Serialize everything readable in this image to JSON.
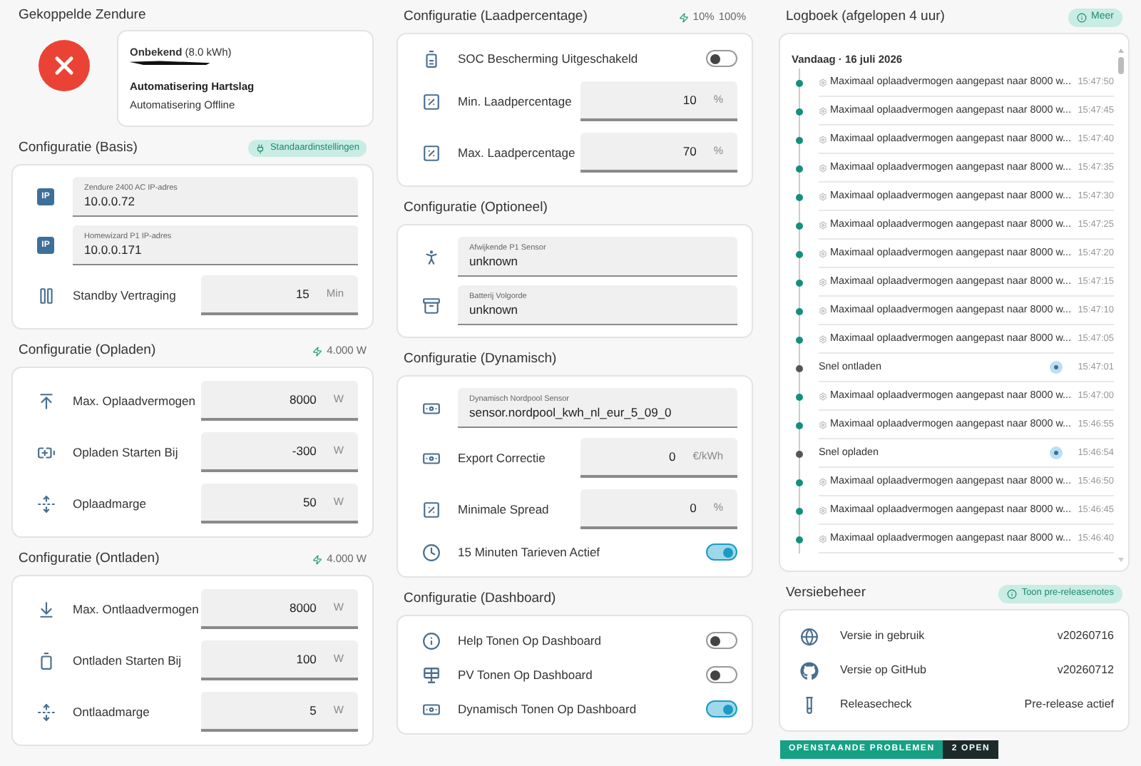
{
  "zendure": {
    "title": "Gekoppelde Zendure",
    "online": false,
    "device": "**Onbekend** (8.0 kWh)",
    "heartbeat_title": "Automatisering Hartslag",
    "heartbeat_status": "Automatisering Offline"
  },
  "config_sections": [
    {
      "title": "Configuratie (Basis)",
      "badge": {
        "kind": "pill",
        "text": "Standaardinstellingen"
      },
      "rows": [
        {
          "kind": "text_field",
          "icon_text": "IP",
          "label": "Zendure 2400 AC IP-adres",
          "value": "10.0.0.72"
        },
        {
          "kind": "text_field",
          "icon_text": "IP",
          "label": "Homewizard P1 IP-adres",
          "value": "10.0.0.171"
        },
        {
          "kind": "number",
          "label": "Standby Vertraging",
          "value": "15",
          "unit": "Min"
        }
      ]
    },
    {
      "title": "Configuratie (Opladen)",
      "badge": {
        "kind": "stat",
        "texts": [
          "4.000 W"
        ]
      },
      "rows": [
        {
          "kind": "number",
          "label": "Max. Oplaadvermogen",
          "value": "8000",
          "unit": "W"
        },
        {
          "kind": "number",
          "label": "Opladen Starten Bij",
          "value": "-300",
          "unit": "W"
        },
        {
          "kind": "number",
          "label": "Oplaadmarge",
          "value": "50",
          "unit": "W"
        }
      ]
    },
    {
      "title": "Configuratie (Ontladen)",
      "badge": {
        "kind": "stat",
        "texts": [
          "4.000 W"
        ]
      },
      "rows": [
        {
          "kind": "number",
          "label": "Max. Ontlaadvermogen",
          "value": "8000",
          "unit": "W"
        },
        {
          "kind": "number",
          "label": "Ontladen Starten Bij",
          "value": "100",
          "unit": "W"
        },
        {
          "kind": "number",
          "label": "Ontlaadmarge",
          "value": "5",
          "unit": "W"
        }
      ]
    },
    {
      "title": "Configuratie (Laadpercentage)",
      "badge": {
        "kind": "stat",
        "texts": [
          "10%",
          "100%"
        ]
      },
      "rows": [
        {
          "kind": "toggle",
          "label": "SOC Bescherming Uitgeschakeld",
          "on": false
        },
        {
          "kind": "number",
          "label": "Min. Laadpercentage",
          "value": "10",
          "unit": "%"
        },
        {
          "kind": "number",
          "label": "Max. Laadpercentage",
          "value": "70",
          "unit": "%"
        }
      ]
    },
    {
      "title": "Configuratie (Optioneel)",
      "rows": [
        {
          "kind": "text_field",
          "label": "Afwijkende P1 Sensor",
          "value": "unknown"
        },
        {
          "kind": "text_field",
          "label": "Batterij Volgorde",
          "value": "unknown"
        }
      ]
    },
    {
      "title": "Configuratie (Dynamisch)",
      "rows": [
        {
          "kind": "text_field",
          "label": "Dynamisch Nordpool Sensor",
          "value": "sensor.nordpool_kwh_nl_eur_5_09_0"
        },
        {
          "kind": "number",
          "label": "Export Correctie",
          "value": "0",
          "unit": "€/kWh"
        },
        {
          "kind": "number",
          "label": "Minimale Spread",
          "value": "0",
          "unit": "%"
        },
        {
          "kind": "toggle",
          "label": "15 Minuten Tarieven Actief",
          "on": true
        }
      ]
    },
    {
      "title": "Configuratie (Dashboard)",
      "rows": [
        {
          "kind": "toggle",
          "label": "Help Tonen Op Dashboard",
          "on": false
        },
        {
          "kind": "toggle",
          "label": "PV Tonen Op Dashboard",
          "on": false
        },
        {
          "kind": "toggle",
          "label": "Dynamisch Tonen Op Dashboard",
          "on": true
        }
      ]
    }
  ],
  "logbook": {
    "title": "Logboek (afgelopen 4 uur)",
    "more_button": "Meer",
    "date": "Vandaag · 16 juli 2026",
    "entries": [
      {
        "kind": "auto",
        "text": "Maximaal oplaadvermogen aangepast naar 8000 w...",
        "time": "15:47:50"
      },
      {
        "kind": "auto",
        "text": "Maximaal oplaadvermogen aangepast naar 8000 w...",
        "time": "15:47:45"
      },
      {
        "kind": "auto",
        "text": "Maximaal oplaadvermogen aangepast naar 8000 w...",
        "time": "15:47:40"
      },
      {
        "kind": "auto",
        "text": "Maximaal oplaadvermogen aangepast naar 8000 w...",
        "time": "15:47:35"
      },
      {
        "kind": "auto",
        "text": "Maximaal oplaadvermogen aangepast naar 8000 w...",
        "time": "15:47:30"
      },
      {
        "kind": "auto",
        "text": "Maximaal oplaadvermogen aangepast naar 8000 w...",
        "time": "15:47:25"
      },
      {
        "kind": "auto",
        "text": "Maximaal oplaadvermogen aangepast naar 8000 w...",
        "time": "15:47:20"
      },
      {
        "kind": "auto",
        "text": "Maximaal oplaadvermogen aangepast naar 8000 w...",
        "time": "15:47:15"
      },
      {
        "kind": "auto",
        "text": "Maximaal oplaadvermogen aangepast naar 8000 w...",
        "time": "15:47:10"
      },
      {
        "kind": "auto",
        "text": "Maximaal oplaadvermogen aangepast naar 8000 w...",
        "time": "15:47:05"
      },
      {
        "kind": "manual",
        "text": "Snel ontladen",
        "time": "15:47:01"
      },
      {
        "kind": "auto",
        "text": "Maximaal oplaadvermogen aangepast naar 8000 w...",
        "time": "15:47:00"
      },
      {
        "kind": "auto",
        "text": "Maximaal oplaadvermogen aangepast naar 8000 w...",
        "time": "15:46:55"
      },
      {
        "kind": "manual",
        "text": "Snel opladen",
        "time": "15:46:54"
      },
      {
        "kind": "auto",
        "text": "Maximaal oplaadvermogen aangepast naar 8000 w...",
        "time": "15:46:50"
      },
      {
        "kind": "auto",
        "text": "Maximaal oplaadvermogen aangepast naar 8000 w...",
        "time": "15:46:45"
      },
      {
        "kind": "auto",
        "text": "Maximaal oplaadvermogen aangepast naar 8000 w...",
        "time": "15:46:40"
      }
    ]
  },
  "versions": {
    "title": "Versiebeheer",
    "notes_button": "Toon pre-releasenotes",
    "rows": [
      {
        "label": "Versie in gebruik",
        "value": "v20260716"
      },
      {
        "label": "Versie op GitHub",
        "value": "v20260712"
      },
      {
        "label": "Releasecheck",
        "value": "Pre-release actief"
      }
    ]
  },
  "issues_badge": {
    "label": "OPENSTAANDE PROBLEMEN",
    "count": "2 OPEN"
  }
}
